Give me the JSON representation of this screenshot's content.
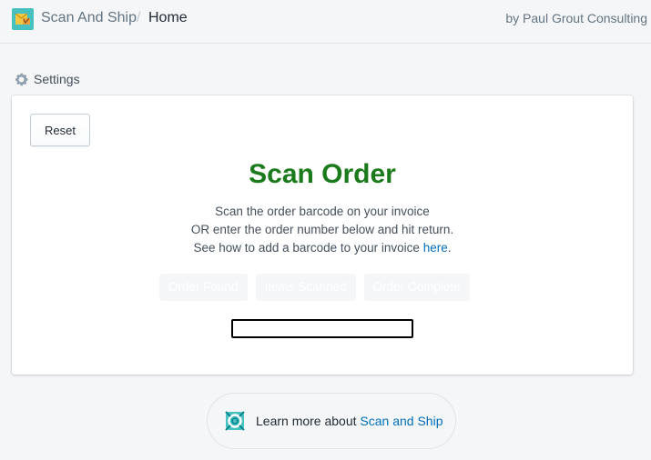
{
  "header": {
    "app_name": "Scan And Ship",
    "separator": "/",
    "page": "Home",
    "byline": "by Paul Grout Consulting",
    "app_icon": "app-logo-icon"
  },
  "settings": {
    "label": "Settings",
    "icon": "gear-icon"
  },
  "card": {
    "reset_label": "Reset",
    "title": "Scan Order",
    "title_color": "#1b7a1b",
    "line1": "Scan the order barcode on your invoice",
    "line2": "OR enter the order number below and hit return.",
    "line3_prefix": "See how to add a barcode to your invoice ",
    "line3_link": "here",
    "line3_suffix": ".",
    "statuses": [
      "Order Found",
      "Items Scanned",
      "Order Complete"
    ],
    "order_input_value": ""
  },
  "footer": {
    "prefix": "Learn more about ",
    "link": "Scan and Ship",
    "icon": "help-lifebuoy-icon"
  },
  "colors": {
    "link": "#006fbb",
    "background": "#f4f6f8"
  }
}
